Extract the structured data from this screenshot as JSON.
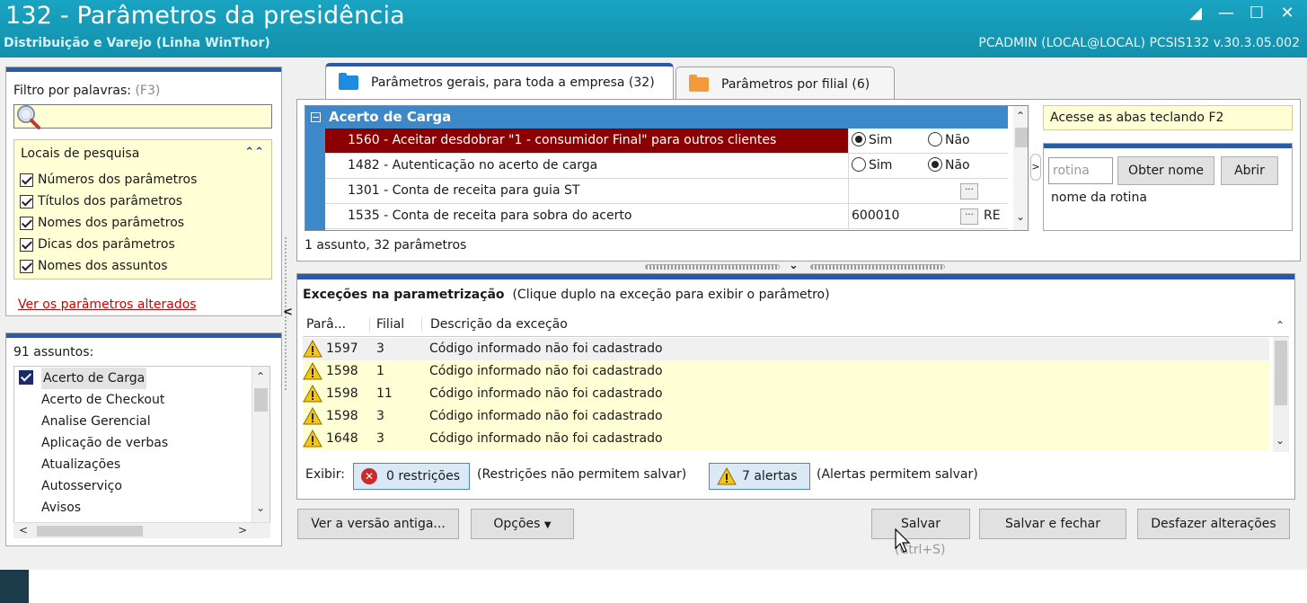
{
  "window": {
    "title": "132 - Parâmetros da presidência",
    "subtitle": "Distribuição e Varejo (Linha WinThor)",
    "userinfo": "PCADMIN (LOCAL@LOCAL)   PCSIS132  v.30.3.05.002"
  },
  "filter": {
    "label": "Filtro por palavras:",
    "shortcut": "(F3)",
    "value": "",
    "places_header": "Locais de pesquisa",
    "places": [
      {
        "label": "Números dos parâmetros",
        "checked": true
      },
      {
        "label": "Títulos dos parâmetros",
        "checked": true
      },
      {
        "label": "Nomes dos parâmetros",
        "checked": true
      },
      {
        "label": "Dicas dos parâmetros",
        "checked": true
      },
      {
        "label": "Nomes dos assuntos",
        "checked": true
      }
    ],
    "changed_link": "Ver os parâmetros alterados"
  },
  "subjects": {
    "count_label": "91 assuntos:",
    "items": [
      "Acerto de Carga",
      "Acerto de Checkout",
      "Analise Gerencial",
      "Aplicação de verbas",
      "Atualizações",
      "Autosserviço",
      "Avisos"
    ]
  },
  "tabs": [
    {
      "label": "Parâmetros gerais, para toda a empresa  (32)",
      "active": true
    },
    {
      "label": "Parâmetros por filial  (6)",
      "active": false
    }
  ],
  "params": {
    "group": "Acerto de Carga",
    "rows": [
      {
        "name": "1560 - Aceitar desdobrar \"1 - consumidor Final\" para outros clientes",
        "type": "radio",
        "yes": "Sim",
        "no": "Não",
        "selected": "Sim"
      },
      {
        "name": "1482 - Autenticação no acerto de carga",
        "type": "radio",
        "yes": "Sim",
        "no": "Não",
        "selected": "Não"
      },
      {
        "name": "1301 - Conta de receita para guia ST",
        "type": "lookup",
        "value": "",
        "extra": ""
      },
      {
        "name": "1535 - Conta de receita para sobra do acerto",
        "type": "lookup",
        "value": "600010",
        "extra": "RE"
      }
    ],
    "count_text": "1 assunto, 32 parâmetros"
  },
  "side": {
    "hint": "Acesse as abas teclando F2",
    "routine_placeholder": "rotina",
    "get_name_label": "Obter nome",
    "open_label": "Abrir",
    "routine_name": "nome da rotina"
  },
  "exceptions": {
    "title": "Exceções na parametrização",
    "subtitle": "(Clique duplo na exceção para exibir o parâmetro)",
    "columns": [
      "Parâ...",
      "Filial",
      "Descrição da exceção"
    ],
    "rows": [
      {
        "param": "1597",
        "filial": "3",
        "desc": "Código informado não foi cadastrado"
      },
      {
        "param": "1598",
        "filial": "1",
        "desc": "Código informado não foi cadastrado"
      },
      {
        "param": "1598",
        "filial": "11",
        "desc": "Código informado não foi cadastrado"
      },
      {
        "param": "1598",
        "filial": "3",
        "desc": "Código informado não foi cadastrado"
      },
      {
        "param": "1648",
        "filial": "3",
        "desc": "Código informado não foi cadastrado"
      }
    ],
    "show_label": "Exibir:",
    "restrictions_btn": "0 restrições",
    "restrictions_note": "(Restrições não permitem salvar)",
    "alerts_btn": "7 alertas",
    "alerts_note": "(Alertas permitem salvar)"
  },
  "buttons": {
    "old_version": "Ver a versão antiga...",
    "options": "Opções",
    "save": "Salvar",
    "save_close": "Salvar e fechar",
    "undo": "Desfazer alterações",
    "save_shortcut": "(Ctrl+S)"
  },
  "colors": {
    "titlebar": "#1a9bb4",
    "accent": "#2a5ba8",
    "selected_row": "#8b0000",
    "highlight": "#ffffd5"
  }
}
